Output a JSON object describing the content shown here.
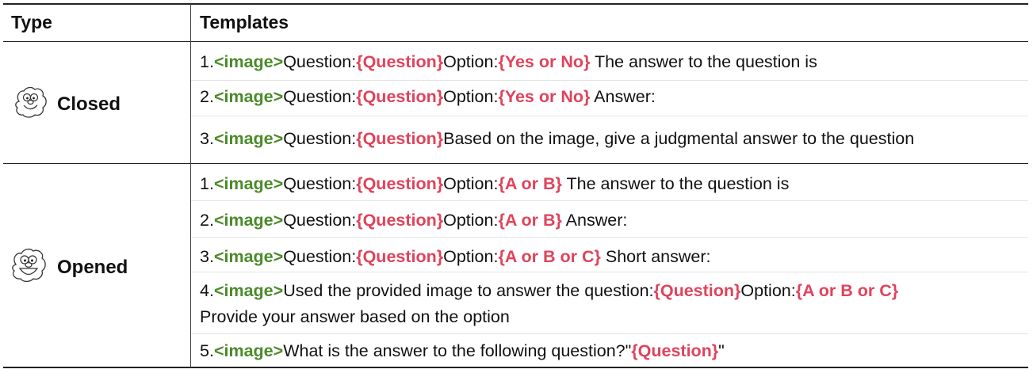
{
  "header": {
    "type": "Type",
    "templates": "Templates"
  },
  "groups": [
    {
      "type": "Closed",
      "icon": "elmo-face-icon",
      "rows": [
        {
          "num": "1.",
          "tag": "<image>",
          "q_label": "Question:",
          "q": "{Question}",
          "opt_label": "Option:",
          "opt": "{Yes or No}",
          "tail": " The answer to the question is"
        },
        {
          "num": "2.",
          "tag": "<image>",
          "q_label": "Question:",
          "q": "{Question}",
          "opt_label": "Option:",
          "opt": "{Yes or No}",
          "tail": " Answer:"
        },
        {
          "num": "3.",
          "tag": "<image>",
          "q_label": "Question:",
          "q": "{Question}",
          "tail": "Based on the image, give a judgmental answer to the question"
        }
      ]
    },
    {
      "type": "Opened",
      "icon": "elmo-face-icon",
      "rows": [
        {
          "num": "1.",
          "tag": "<image>",
          "q_label": "Question:",
          "q": "{Question}",
          "opt_label": "Option:",
          "opt": "{A or B}",
          "tail": " The answer to the question is"
        },
        {
          "num": "2.",
          "tag": "<image>",
          "q_label": "Question:",
          "q": "{Question}",
          "opt_label": "Option:",
          "opt": "{A or B}",
          "tail": " Answer:"
        },
        {
          "num": "3.",
          "tag": "<image>",
          "q_label": "Question:",
          "q": "{Question}",
          "opt_label": "Option:",
          "opt": "{A or B or C}",
          "tail": " Short answer:"
        },
        {
          "num": "4.",
          "tag": "<image>",
          "pre": "Used the provided image to answer the question:",
          "q": "{Question}",
          "opt_label": "Option:",
          "opt": "{A or B or C}",
          "line2": "Provide your answer based on the option"
        },
        {
          "num": "5.",
          "tag": "<image>",
          "pre": "What is the answer to the following question?\"",
          "q": "{Question}",
          "tail": "\""
        }
      ]
    }
  ],
  "colors": {
    "tag": "#4c8a2a",
    "placeholder": "#e0435b",
    "rule": "#222222"
  }
}
